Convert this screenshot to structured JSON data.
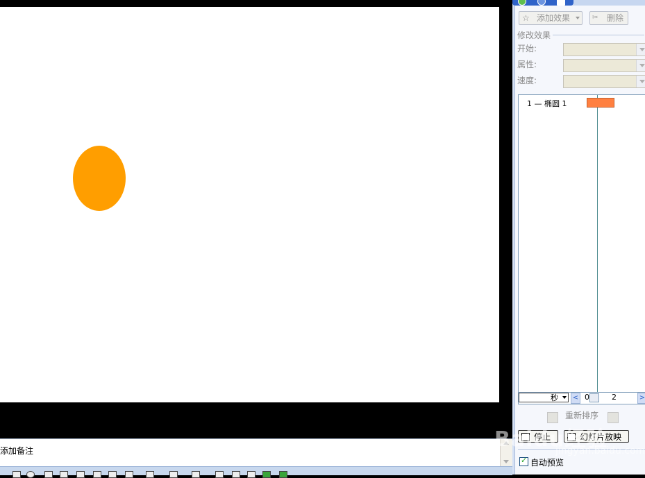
{
  "custom_animation": {
    "add_effect": "添加效果",
    "delete": "删除",
    "modify_effect_title": "修改效果",
    "start_label": "开始:",
    "property_label": "属性:",
    "speed_label": "速度:",
    "items": [
      {
        "index": "1",
        "shape_name": "椭圆 1"
      }
    ],
    "time_unit": "秒",
    "scale_start": "0",
    "scale_mark": "2",
    "reorder_label": "重新排序",
    "stop_button": "停止",
    "slideshow_button": "幻灯片放映",
    "autopreview_label": "自动预览",
    "autopreview_checked": true
  },
  "notes": {
    "placeholder": "添加备注"
  },
  "slide": {
    "oval_color": "#ff9e00"
  },
  "watermark": {
    "text": "Baidu经验",
    "subtext": "jingyan.baidu.com"
  }
}
